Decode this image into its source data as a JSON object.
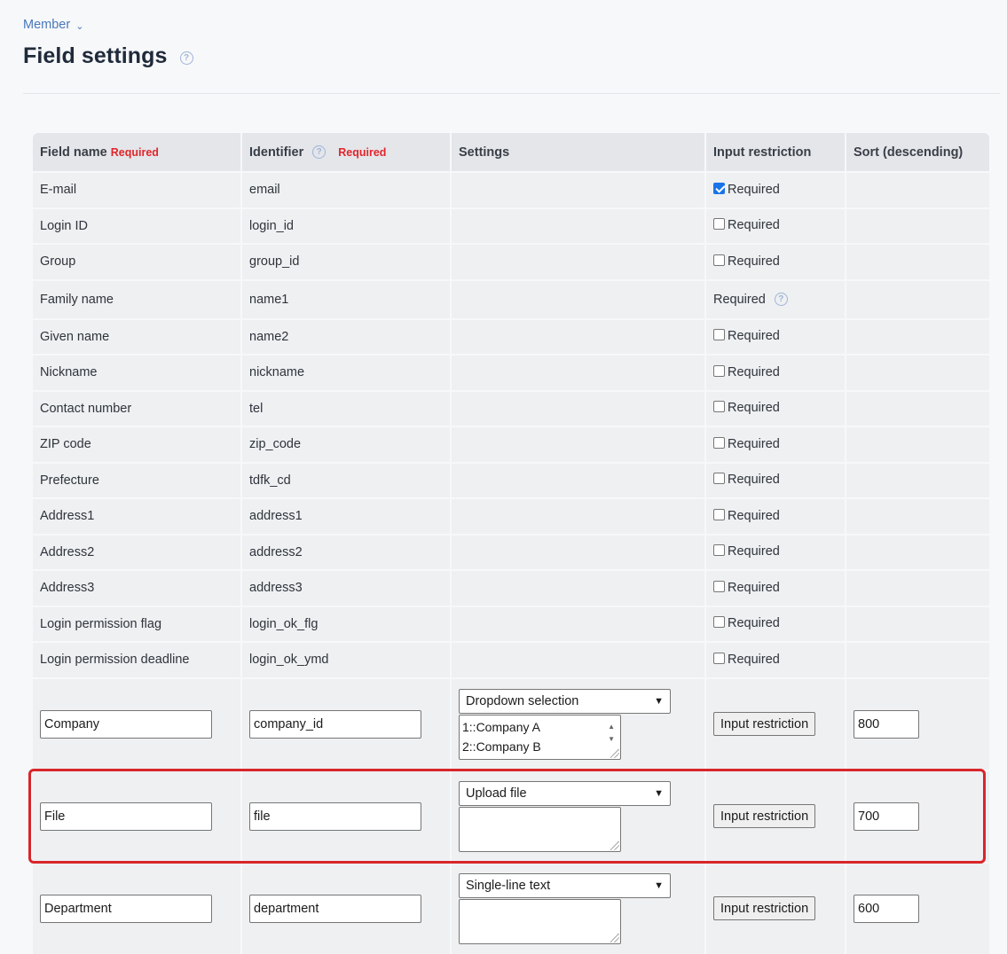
{
  "breadcrumb": {
    "label": "Member",
    "chevron": "⌄"
  },
  "page": {
    "title": "Field settings",
    "help": "?"
  },
  "table": {
    "headers": {
      "field_name": "Field name",
      "field_name_req": "Required",
      "identifier": "Identifier",
      "identifier_req": "Required",
      "settings": "Settings",
      "input_restriction": "Input restriction",
      "sort": "Sort (descending)"
    },
    "required_label": "Required",
    "fixed_rows": [
      {
        "name": "E-mail",
        "id": "email",
        "checked": true
      },
      {
        "name": "Login ID",
        "id": "login_id",
        "checked": false
      },
      {
        "name": "Group",
        "id": "group_id",
        "checked": false
      },
      {
        "name": "Family name",
        "id": "name1",
        "checked": null
      },
      {
        "name": "Given name",
        "id": "name2",
        "checked": false
      },
      {
        "name": "Nickname",
        "id": "nickname",
        "checked": false
      },
      {
        "name": "Contact number",
        "id": "tel",
        "checked": false
      },
      {
        "name": "ZIP code",
        "id": "zip_code",
        "checked": false
      },
      {
        "name": "Prefecture",
        "id": "tdfk_cd",
        "checked": false
      },
      {
        "name": "Address1",
        "id": "address1",
        "checked": false
      },
      {
        "name": "Address2",
        "id": "address2",
        "checked": false
      },
      {
        "name": "Address3",
        "id": "address3",
        "checked": false
      },
      {
        "name": "Login permission flag",
        "id": "login_ok_flg",
        "checked": false
      },
      {
        "name": "Login permission deadline",
        "id": "login_ok_ymd",
        "checked": false
      }
    ],
    "edit_rows": [
      {
        "name": "Company",
        "id": "company_id",
        "type": "Dropdown selection",
        "options_text": [
          "1::Company A",
          "2::Company B"
        ],
        "button": "Input restriction",
        "sort": "800"
      },
      {
        "name": "File",
        "id": "file",
        "type": "Upload file",
        "options_text": [],
        "button": "Input restriction",
        "sort": "700"
      },
      {
        "name": "Department",
        "id": "department",
        "type": "Single-line text",
        "options_text": [],
        "button": "Input restriction",
        "sort": "600"
      }
    ]
  },
  "colors": {
    "highlight": "#d8262b",
    "required_tag": "#e1252b",
    "link": "#4a78b8"
  }
}
